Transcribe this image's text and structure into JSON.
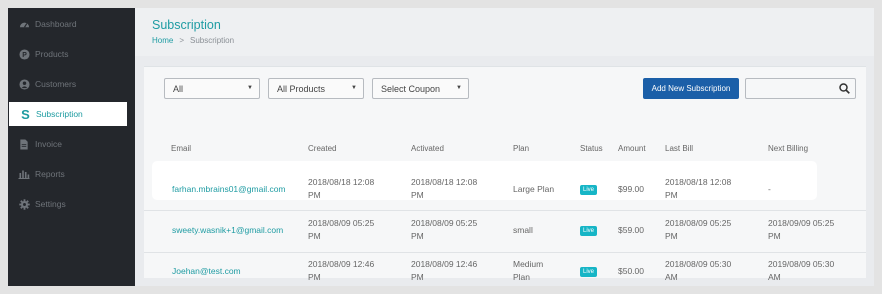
{
  "sidebar": {
    "items": [
      {
        "label": "Dashboard",
        "icon": "dashboard-icon"
      },
      {
        "label": "Products",
        "icon": "p-badge-icon"
      },
      {
        "label": "Customers",
        "icon": "user-icon"
      },
      {
        "label": "Subscription",
        "icon": "s-icon",
        "active": true
      },
      {
        "label": "Invoice",
        "icon": "document-icon"
      },
      {
        "label": "Reports",
        "icon": "bar-chart-icon"
      },
      {
        "label": "Settings",
        "icon": "gear-icon"
      }
    ]
  },
  "header": {
    "title": "Subscription",
    "breadcrumb": {
      "home": "Home",
      "separator": ">",
      "current": "Subscription"
    }
  },
  "filters": {
    "all": "All",
    "products": "All Products",
    "coupon": "Select Coupon"
  },
  "toolbar": {
    "add_label": "Add New Subscription",
    "search_placeholder": ""
  },
  "table": {
    "headers": [
      "Email",
      "Created",
      "Activated",
      "Plan",
      "Status",
      "Amount",
      "Last Bill",
      "Next Billing"
    ],
    "rows": [
      {
        "email": "farhan.mbrains01@gmail.com",
        "created": [
          "2018/08/18 12:08",
          "PM"
        ],
        "activated": [
          "2018/08/18 12:08",
          "PM"
        ],
        "plan": [
          "Large Plan",
          ""
        ],
        "status": "Live",
        "amount": "$99.00",
        "last_bill": [
          "2018/08/18 12:08",
          "PM"
        ],
        "next_billing": [
          "-",
          ""
        ]
      },
      {
        "email": "sweety.wasnik+1@gmail.com",
        "created": [
          "2018/08/09 05:25",
          "PM"
        ],
        "activated": [
          "2018/08/09 05:25",
          "PM"
        ],
        "plan": [
          "small",
          ""
        ],
        "status": "Live",
        "amount": "$59.00",
        "last_bill": [
          "2018/08/09 05:25",
          "PM"
        ],
        "next_billing": [
          "2018/09/09 05:25",
          "PM"
        ]
      },
      {
        "email": "Joehan@test.com",
        "created": [
          "2018/08/09 12:46",
          "PM"
        ],
        "activated": [
          "2018/08/09 12:46",
          "PM"
        ],
        "plan": [
          "Medium",
          "Plan"
        ],
        "status": "Live",
        "amount": "$50.00",
        "last_bill": [
          "2018/08/09 05:30",
          "AM"
        ],
        "next_billing": [
          "2019/08/09 05:30",
          "AM"
        ]
      }
    ]
  },
  "colors": {
    "accent": "#1f9ca3",
    "sidebar_bg": "#24272c",
    "primary_button": "#1b5fa8",
    "live_badge": "#16b5c6"
  }
}
